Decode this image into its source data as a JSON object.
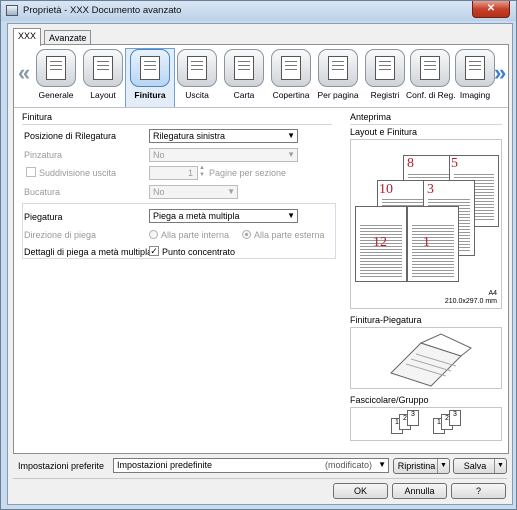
{
  "window": {
    "title": "Proprietà - XXX Documento avanzato",
    "close_symbol": "✕"
  },
  "tabs": [
    {
      "label": "XXX",
      "active": true
    },
    {
      "label": "Avanzate",
      "active": false
    }
  ],
  "toolbar": {
    "prev_arrow": "«",
    "next_arrow": "»",
    "items": [
      {
        "label": "Generale",
        "icon": "general-icon"
      },
      {
        "label": "Layout",
        "icon": "layout-icon"
      },
      {
        "label": "Finitura",
        "icon": "finishing-icon",
        "selected": true
      },
      {
        "label": "Uscita",
        "icon": "output-icon"
      },
      {
        "label": "Carta",
        "icon": "paper-icon"
      },
      {
        "label": "Copertina",
        "icon": "cover-icon"
      },
      {
        "label": "Per pagina",
        "icon": "per-page-icon"
      },
      {
        "label": "Registri",
        "icon": "tabs-icon"
      },
      {
        "label": "Conf. di Reg.",
        "icon": "tab-settings-icon"
      },
      {
        "label": "Imaging",
        "icon": "imaging-icon"
      }
    ]
  },
  "finishing": {
    "section_title": "Finitura",
    "binding_position": {
      "label": "Posizione di Rilegatura",
      "value": "Rilegatura sinistra"
    },
    "stapling": {
      "label": "Pinzatura",
      "value": "No"
    },
    "split_output": {
      "label": "Suddivisione uscita",
      "checked": false,
      "value": "1",
      "unit": "Pagine per sezione"
    },
    "punch": {
      "label": "Bucatura",
      "value": "No"
    },
    "folding": {
      "label": "Piegatura",
      "value": "Piega a metà multipla"
    },
    "fold_direction": {
      "label": "Direzione di piega",
      "option_inside": "Alla parte interna",
      "option_outside": "Alla parte esterna",
      "selected": "outside"
    },
    "fold_details": {
      "label": "Dettagli di piega a metà multipla",
      "checkbox_label": "Punto concentrato",
      "checked": true,
      "check_symbol": "✓"
    }
  },
  "preview": {
    "section_title": "Anteprima",
    "layout_title": "Layout e Finitura",
    "page_numbers": [
      "8",
      "5",
      "10",
      "3",
      "12",
      "1"
    ],
    "paper_size": "A4",
    "paper_dims": "210.0x297.0 mm",
    "fold_title": "Finitura-Piegatura",
    "collate_title": "Fascicolare/Gruppo",
    "collate_digits": [
      "1",
      "2",
      "3",
      "1",
      "2",
      "3"
    ]
  },
  "footer": {
    "favorites_label": "Impostazioni preferite",
    "favorites_value": "Impostazioni predefinite",
    "favorites_status": "(modificato)",
    "restore_label": "Ripristina",
    "save_label": "Salva",
    "ok_label": "OK",
    "cancel_label": "Annulla",
    "help_label": "?"
  }
}
